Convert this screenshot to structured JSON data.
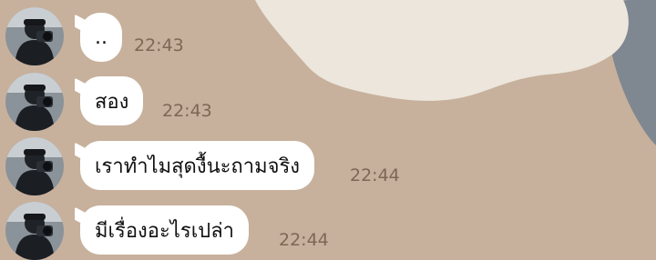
{
  "colors": {
    "wallpaper_base": "#c7b19c",
    "wallpaper_cream": "#ece6dc",
    "wallpaper_slate": "#7f8791",
    "bubble": "#ffffff",
    "time_text": "#7d6755"
  },
  "messages": [
    {
      "text": "..",
      "time": "22:43"
    },
    {
      "text": "สอง",
      "time": "22:43"
    },
    {
      "text": "เราทำไมสุดงื้นะถามจริง",
      "time": "22:44"
    },
    {
      "text": "มีเรื่องอะไรเปล่า",
      "time": "22:44"
    }
  ]
}
